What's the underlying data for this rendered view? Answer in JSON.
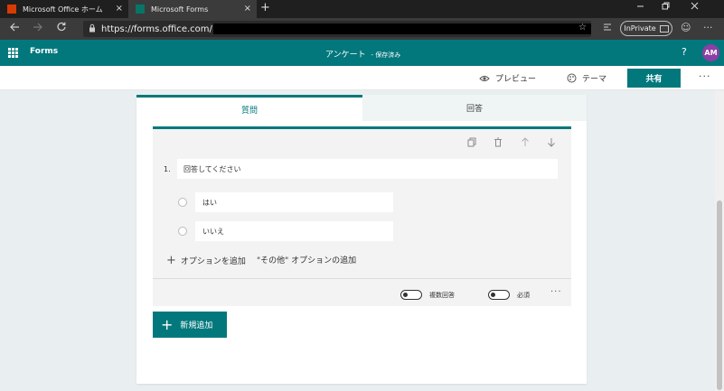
{
  "browser": {
    "tabs": [
      {
        "title": "Microsoft Office ホーム",
        "icon": "office-icon",
        "active": false
      },
      {
        "title": "Microsoft Forms",
        "icon": "forms-icon",
        "active": true
      }
    ],
    "close_glyph": "×",
    "new_tab_glyph": "+",
    "url": "https://forms.office.com/",
    "inprivate_label": "InPrivate"
  },
  "app": {
    "name": "Forms",
    "doc_title": "アンケート",
    "save_status": "- 保存済み",
    "help_glyph": "?",
    "avatar_initials": "AM",
    "avatar_color": "#8c3fa4",
    "accent_color": "#03787c"
  },
  "commands": {
    "preview_label": "プレビュー",
    "theme_label": "テーマ",
    "share_label": "共有",
    "more_glyph": "···"
  },
  "form": {
    "tabs": [
      {
        "label": "質問",
        "active": true
      },
      {
        "label": "回答",
        "active": false
      }
    ],
    "question": {
      "number": "1.",
      "title": "回答してください",
      "options": [
        "はい",
        "いいえ"
      ],
      "add_option_label": "オプションを追加",
      "add_other_label": "\"その他\" オプションの追加",
      "multiple_answers_label": "複数回答",
      "multiple_answers_on": false,
      "required_label": "必須",
      "required_on": false,
      "more_glyph": "···"
    },
    "add_new_label": "新規追加"
  }
}
